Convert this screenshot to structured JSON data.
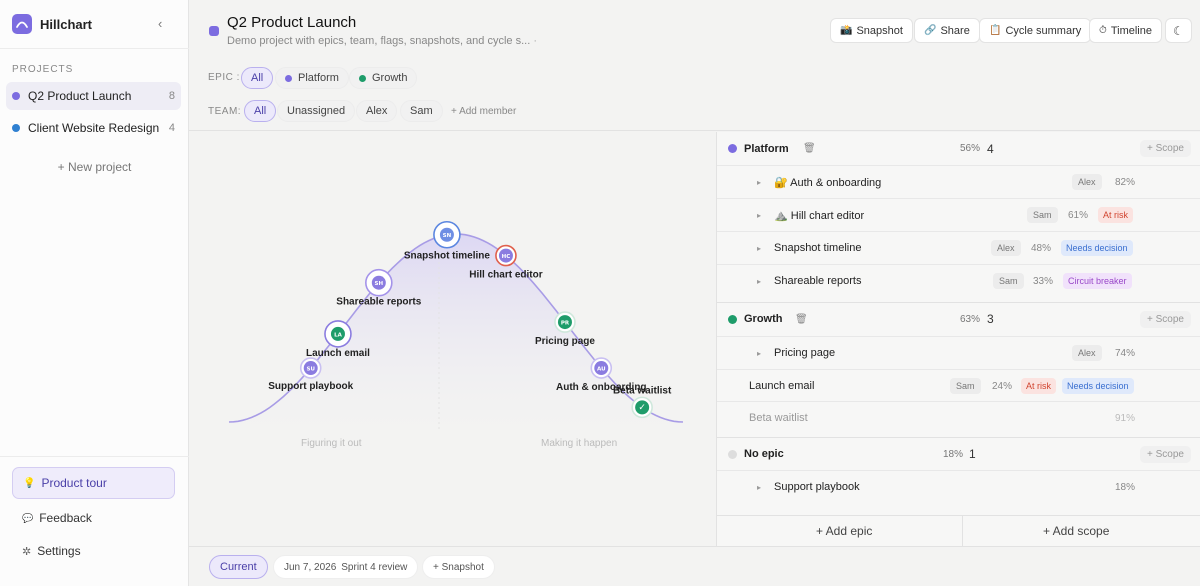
{
  "app": {
    "name": "Hillchart"
  },
  "sidebar": {
    "section_label": "PROJECTS",
    "projects": [
      {
        "name": "Q2 Product Launch",
        "count": "8",
        "color": "#7c6ce0",
        "active": true
      },
      {
        "name": "Client Website Redesign",
        "count": "4",
        "color": "#2f80d1",
        "active": false
      }
    ],
    "new_project": "+ New project",
    "product_tour": "Product tour",
    "feedback": "Feedback",
    "settings": "Settings"
  },
  "header": {
    "title": "Q2 Product Launch",
    "subtitle": "Demo project with epics, team, flags, snapshots, and cycle s...",
    "buttons": {
      "snapshot": "Snapshot",
      "share": "Share",
      "cycle_summary": "Cycle summary",
      "timeline": "Timeline"
    }
  },
  "filters": {
    "epic_label": "EPIC :",
    "epic_chips": [
      {
        "label": "All",
        "selected": true
      },
      {
        "label": "Platform",
        "color": "#7c6ce0"
      },
      {
        "label": "Growth",
        "color": "#1e9c6a"
      }
    ],
    "team_label": "TEAM:",
    "team_chips": [
      {
        "label": "All",
        "selected": true
      },
      {
        "label": "Unassigned"
      },
      {
        "label": "Alex"
      },
      {
        "label": "Sam"
      }
    ],
    "add_member": "+ Add member"
  },
  "hill": {
    "phase_left": "Figuring it out",
    "phase_right": "Making it happen",
    "scopes": [
      {
        "label": "Support playbook",
        "initials": "SU",
        "progress": 18
      },
      {
        "label": "Launch email",
        "initials": "LA",
        "progress": 24
      },
      {
        "label": "Shareable reports",
        "initials": "SH",
        "progress": 33
      },
      {
        "label": "Snapshot timeline",
        "initials": "SN",
        "progress": 48
      },
      {
        "label": "Hill chart editor",
        "initials": "HC",
        "progress": 61
      },
      {
        "label": "Pricing page",
        "initials": "PR",
        "progress": 74
      },
      {
        "label": "Auth & onboarding",
        "initials": "AU",
        "progress": 82
      },
      {
        "label": "Beta waitlist",
        "initials": "✓",
        "progress": 91
      }
    ]
  },
  "panel": {
    "groups": [
      {
        "name": "Platform",
        "pct": "56%",
        "count": "4",
        "scope": "+ Scope",
        "color": "#7c6ce0"
      },
      {
        "name": "Growth",
        "pct": "63%",
        "count": "3",
        "scope": "+ Scope",
        "color": "#1e9c6a"
      },
      {
        "name": "No epic",
        "pct": "18%",
        "count": "1",
        "scope": "+ Scope",
        "color": "#dddddd"
      }
    ],
    "rows": [
      {
        "name": "🔐 Auth & onboarding",
        "person": "Alex",
        "pct": "82%"
      },
      {
        "name": "⛰️ Hill chart editor",
        "person": "Sam",
        "pct": "61%",
        "tag1": "At risk"
      },
      {
        "name": "Snapshot timeline",
        "person": "Alex",
        "pct": "48%",
        "tag1": "Needs decision"
      },
      {
        "name": "Shareable reports",
        "person": "Sam",
        "pct": "33%",
        "tag1": "Circuit breaker"
      },
      {
        "name": "Pricing page",
        "person": "Alex",
        "pct": "74%"
      },
      {
        "name": "Launch email",
        "person": "Sam",
        "pct": "24%",
        "tag1": "At risk",
        "tag2": "Needs decision"
      },
      {
        "name": "Beta waitlist",
        "pct": "91%"
      },
      {
        "name": "Support playbook",
        "pct": "18%"
      }
    ],
    "add_epic": "+ Add epic",
    "add_scope": "+ Add scope"
  },
  "footer": {
    "current": "Current",
    "snapshot_date": "Jun 7, 2026",
    "snapshot_name": "Sprint 4 review",
    "add_snapshot": "+ Snapshot"
  }
}
